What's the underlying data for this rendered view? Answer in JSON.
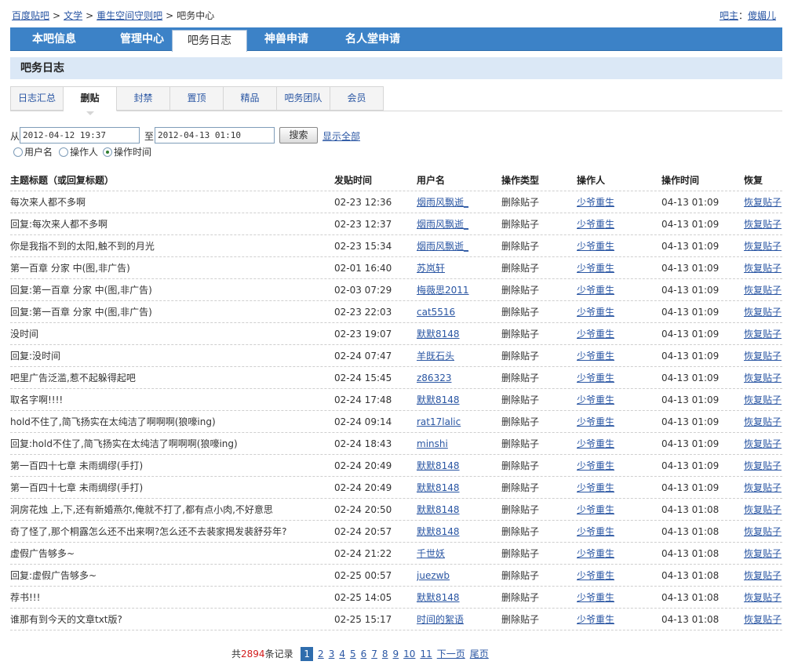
{
  "breadcrumb": {
    "items": [
      "百度贴吧",
      "文学",
      "重生空间守则吧"
    ],
    "separator": ">",
    "current": "吧务中心"
  },
  "owner": {
    "label": "吧主",
    "colon": "：",
    "name": "傻媚儿"
  },
  "main_nav": {
    "tabs": [
      "本吧信息",
      "管理中心",
      "吧务日志",
      "神兽申请",
      "名人堂申请"
    ],
    "active_index": 2
  },
  "section_title": "吧务日志",
  "sub_tabs": {
    "tabs": [
      "日志汇总",
      "删贴",
      "封禁",
      "置顶",
      "精品",
      "吧务团队",
      "会员"
    ],
    "active_index": 1
  },
  "filter": {
    "from_label": "从",
    "from_value": "2012-04-12 19:37",
    "to_label": "至",
    "to_value": "2012-04-13 01:10",
    "search_label": "搜索",
    "show_all_label": "显示全部",
    "radios": [
      {
        "label": "用户名",
        "checked": false
      },
      {
        "label": "操作人",
        "checked": false
      },
      {
        "label": "操作时间",
        "checked": true
      }
    ]
  },
  "table": {
    "headers": [
      "主题标题（或回复标题）",
      "发贴时间",
      "用户名",
      "操作类型",
      "操作人",
      "操作时间",
      "恢复"
    ],
    "rows": [
      [
        "每次来人都不多啊",
        "02-23 12:36",
        "烟雨风飘逝_",
        "删除贴子",
        "少爷重生",
        "04-13 01:09",
        "恢复贴子"
      ],
      [
        "回复:每次来人都不多啊",
        "02-23 12:37",
        "烟雨风飘逝_",
        "删除贴子",
        "少爷重生",
        "04-13 01:09",
        "恢复贴子"
      ],
      [
        "你是我指不到的太阳,触不到的月光",
        "02-23 15:34",
        "烟雨风飘逝_",
        "删除贴子",
        "少爷重生",
        "04-13 01:09",
        "恢复贴子"
      ],
      [
        "第一百章 分家 中(图,非广告)",
        "02-01 16:40",
        "苏岚轩",
        "删除贴子",
        "少爷重生",
        "04-13 01:09",
        "恢复贴子"
      ],
      [
        "回复:第一百章 分家 中(图,非广告)",
        "02-03 07:29",
        "梅薇思2011",
        "删除贴子",
        "少爷重生",
        "04-13 01:09",
        "恢复贴子"
      ],
      [
        "回复:第一百章 分家 中(图,非广告)",
        "02-23 22:03",
        "cat5516",
        "删除贴子",
        "少爷重生",
        "04-13 01:09",
        "恢复贴子"
      ],
      [
        "没时间",
        "02-23 19:07",
        "默默8148",
        "删除贴子",
        "少爷重生",
        "04-13 01:09",
        "恢复贴子"
      ],
      [
        "回复:没时间",
        "02-24 07:47",
        "羊既石头",
        "删除贴子",
        "少爷重生",
        "04-13 01:09",
        "恢复贴子"
      ],
      [
        "吧里广告泛滥,惹不起躲得起吧",
        "02-24 15:45",
        "z86323",
        "删除贴子",
        "少爷重生",
        "04-13 01:09",
        "恢复贴子"
      ],
      [
        "取名字啊!!!!",
        "02-24 17:48",
        "默默8148",
        "删除贴子",
        "少爷重生",
        "04-13 01:09",
        "恢复贴子"
      ],
      [
        "hold不住了,简飞扬实在太纯洁了啊啊啊(狼嚎ing)",
        "02-24 09:14",
        "rat17lalic",
        "删除贴子",
        "少爷重生",
        "04-13 01:09",
        "恢复贴子"
      ],
      [
        "回复:hold不住了,简飞扬实在太纯洁了啊啊啊(狼嚎ing)",
        "02-24 18:43",
        "minshi",
        "删除贴子",
        "少爷重生",
        "04-13 01:09",
        "恢复贴子"
      ],
      [
        "第一百四十七章 未雨绸缪(手打)",
        "02-24 20:49",
        "默默8148",
        "删除贴子",
        "少爷重生",
        "04-13 01:09",
        "恢复贴子"
      ],
      [
        "第一百四十七章 未雨绸缪(手打)",
        "02-24 20:49",
        "默默8148",
        "删除贴子",
        "少爷重生",
        "04-13 01:09",
        "恢复贴子"
      ],
      [
        "洞房花烛 上,下,还有新婚燕尔,俺就不打了,都有点小肉,不好意思",
        "02-24 20:50",
        "默默8148",
        "删除贴子",
        "少爷重生",
        "04-13 01:08",
        "恢复贴子"
      ],
      [
        "奇了怪了,那个桐露怎么还不出来啊?怎么还不去裴家揭发裴舒芬年?",
        "02-24 20:57",
        "默默8148",
        "删除贴子",
        "少爷重生",
        "04-13 01:08",
        "恢复贴子"
      ],
      [
        "虚假广告够多~",
        "02-24 21:22",
        "千世妖",
        "删除贴子",
        "少爷重生",
        "04-13 01:08",
        "恢复贴子"
      ],
      [
        "回复:虚假广告够多~",
        "02-25 00:57",
        "juezwb",
        "删除贴子",
        "少爷重生",
        "04-13 01:08",
        "恢复贴子"
      ],
      [
        "荐书!!!",
        "02-25 14:05",
        "默默8148",
        "删除贴子",
        "少爷重生",
        "04-13 01:08",
        "恢复贴子"
      ],
      [
        "谁那有到今天的文章txt版?",
        "02-25 15:17",
        "时间的絮语",
        "删除贴子",
        "少爷重生",
        "04-13 01:08",
        "恢复贴子"
      ]
    ]
  },
  "pager": {
    "total_prefix": "共",
    "total_count": "2894",
    "total_suffix": "条记录",
    "pages": [
      "1",
      "2",
      "3",
      "4",
      "5",
      "6",
      "7",
      "8",
      "9",
      "10",
      "11"
    ],
    "current_index": 0,
    "next_label": "下一页",
    "last_label": "尾页"
  },
  "colors": {
    "nav_blue": "#3c82c7",
    "section_bg": "#dbe8f6",
    "link": "#2a56a3",
    "count_red": "#d21b1b"
  }
}
